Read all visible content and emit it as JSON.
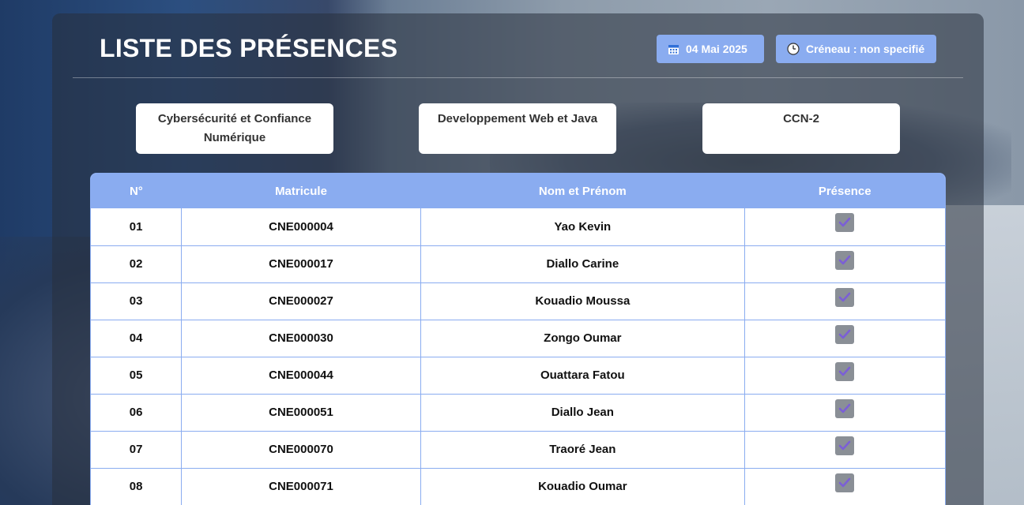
{
  "header": {
    "title": "LISTE DES PRÉSENCES",
    "date_icon": "calendar-icon",
    "date_label": "04 Mai 2025",
    "slot_icon": "clock-icon",
    "slot_label": "Créneau : non specifié"
  },
  "info": {
    "filiere": "Cybersécurité et Confiance Numérique",
    "matiere": "Developpement Web et Java",
    "classe": "CCN-2"
  },
  "table": {
    "columns": [
      "N°",
      "Matricule",
      "Nom et Prénom",
      "Présence"
    ],
    "rows": [
      {
        "n": "01",
        "matricule": "CNE000004",
        "nom": "Yao Kevin",
        "present": true
      },
      {
        "n": "02",
        "matricule": "CNE000017",
        "nom": "Diallo Carine",
        "present": true
      },
      {
        "n": "03",
        "matricule": "CNE000027",
        "nom": "Kouadio Moussa",
        "present": true
      },
      {
        "n": "04",
        "matricule": "CNE000030",
        "nom": "Zongo Oumar",
        "present": true
      },
      {
        "n": "05",
        "matricule": "CNE000044",
        "nom": "Ouattara Fatou",
        "present": true
      },
      {
        "n": "06",
        "matricule": "CNE000051",
        "nom": "Diallo Jean",
        "present": true
      },
      {
        "n": "07",
        "matricule": "CNE000070",
        "nom": "Traoré Jean",
        "present": true
      },
      {
        "n": "08",
        "matricule": "CNE000071",
        "nom": "Kouadio Oumar",
        "present": true
      }
    ]
  },
  "colors": {
    "accent": "#8aacf0",
    "checkbox": "#8a8f96",
    "check": "#7b5fd6"
  }
}
